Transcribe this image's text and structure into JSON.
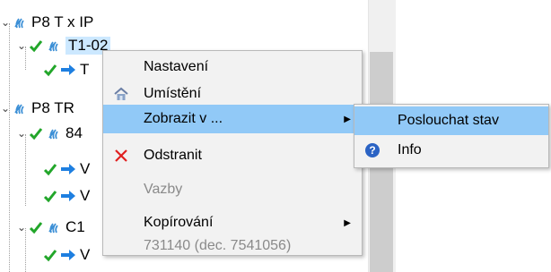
{
  "tree": {
    "nodes": [
      {
        "label": "P8 T x IP",
        "level": 0,
        "icon": "wifi-signal-icon"
      },
      {
        "label": "T1-02",
        "level": 1,
        "icon": "wifi-signal-icon",
        "checked": true,
        "selected": true
      },
      {
        "label": "T",
        "level": 2,
        "icon": "arrow-right-icon",
        "checked": true
      },
      {
        "label": "P8 TR",
        "level": 0,
        "icon": "wifi-signal-icon"
      },
      {
        "label": "84",
        "level": 1,
        "icon": "wifi-signal-icon",
        "checked": true
      },
      {
        "label": "V",
        "level": 2,
        "icon": "arrow-right-icon",
        "checked": true
      },
      {
        "label": "V",
        "level": 2,
        "icon": "arrow-right-icon",
        "checked": true
      },
      {
        "label": "C1",
        "level": 1,
        "icon": "wifi-signal-icon",
        "checked": true
      },
      {
        "label": "V",
        "level": 2,
        "icon": "arrow-right-icon",
        "checked": true
      }
    ]
  },
  "context_menu": {
    "items": [
      {
        "label": "Nastavení",
        "icon": ""
      },
      {
        "label": "Umístění",
        "icon": "house-icon"
      },
      {
        "label": "Zobrazit v ...",
        "icon": "",
        "submenu": true,
        "highlighted": true
      },
      {
        "label": "Odstranit",
        "icon": "red-x-icon"
      },
      {
        "label": "Vazby",
        "icon": "",
        "disabled": true
      },
      {
        "label": "Kopírování",
        "icon": "",
        "submenu": true
      },
      {
        "label": "731140 (dec. 7541056)",
        "icon": "",
        "disabled": true
      }
    ]
  },
  "submenu": {
    "items": [
      {
        "label": "Poslouchat stav",
        "highlighted": true
      },
      {
        "label": "Info",
        "icon": "help-icon"
      }
    ]
  },
  "colors": {
    "check": "#22a62a",
    "arrow": "#1e7fe0",
    "signal": "#3b8fd6",
    "highlight": "#91c9f7",
    "delete": "#e02020"
  }
}
